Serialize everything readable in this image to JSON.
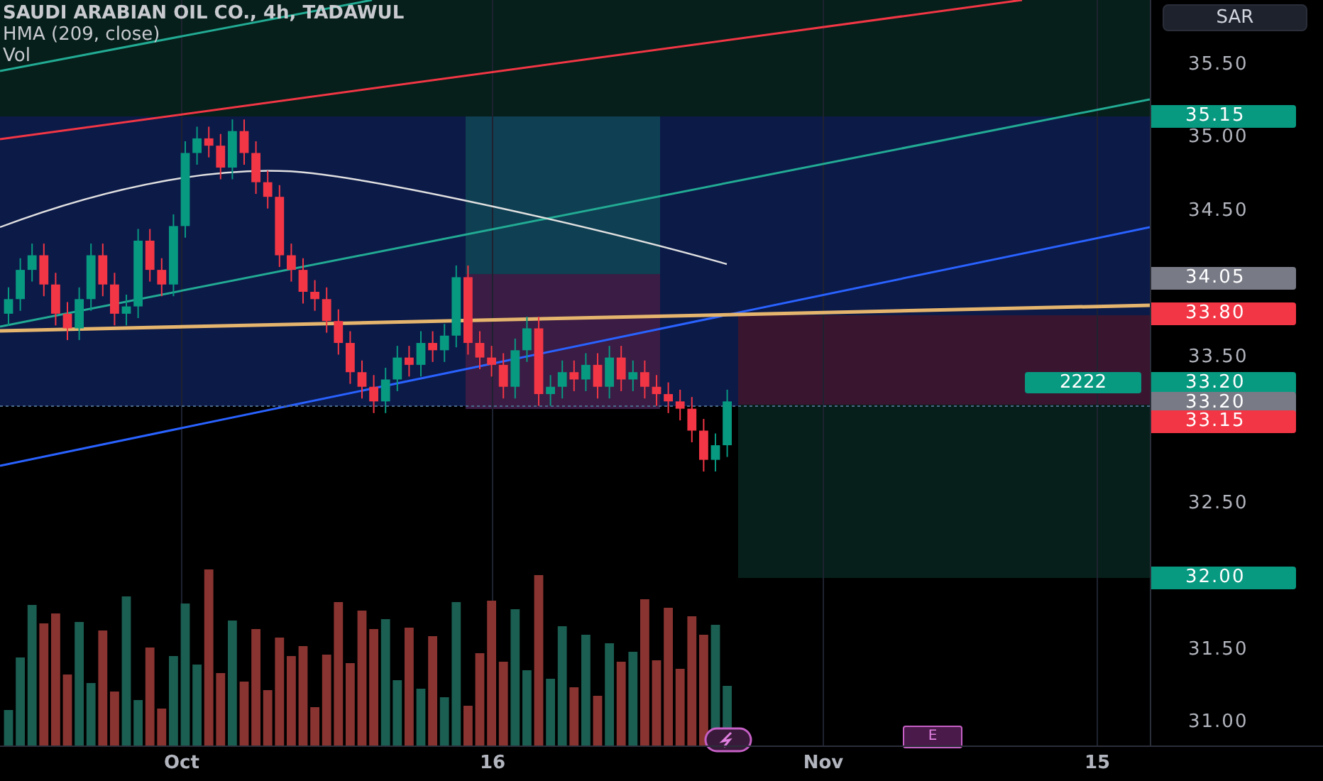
{
  "legend": {
    "symbol": "SAUDI ARABIAN OIL CO., 4h, TADAWUL",
    "indicators": [
      "HMA (209, close)",
      "Vol"
    ]
  },
  "currency_button": "SAR",
  "price_axis": {
    "ticks": [
      "35.50",
      "35.00",
      "34.50",
      "33.50",
      "32.50",
      "31.50",
      "31.00"
    ]
  },
  "price_labels": [
    {
      "text": "35.15",
      "color": "#089981"
    },
    {
      "text": "34.05",
      "color": "#787b86"
    },
    {
      "text": "33.80",
      "color": "#f23645"
    },
    {
      "text": "33.20",
      "color": "#089981"
    },
    {
      "text": "33.20",
      "color": "#787b86"
    },
    {
      "text": "33.15",
      "color": "#f23645"
    },
    {
      "text": "32.00",
      "color": "#089981"
    }
  ],
  "position_badge": {
    "text": "2222",
    "color": "#089981"
  },
  "time_axis": {
    "ticks": [
      "Oct",
      "16",
      "Nov",
      "15"
    ]
  },
  "events": [
    {
      "kind": "split"
    },
    {
      "kind": "earnings",
      "text": "E"
    }
  ]
}
